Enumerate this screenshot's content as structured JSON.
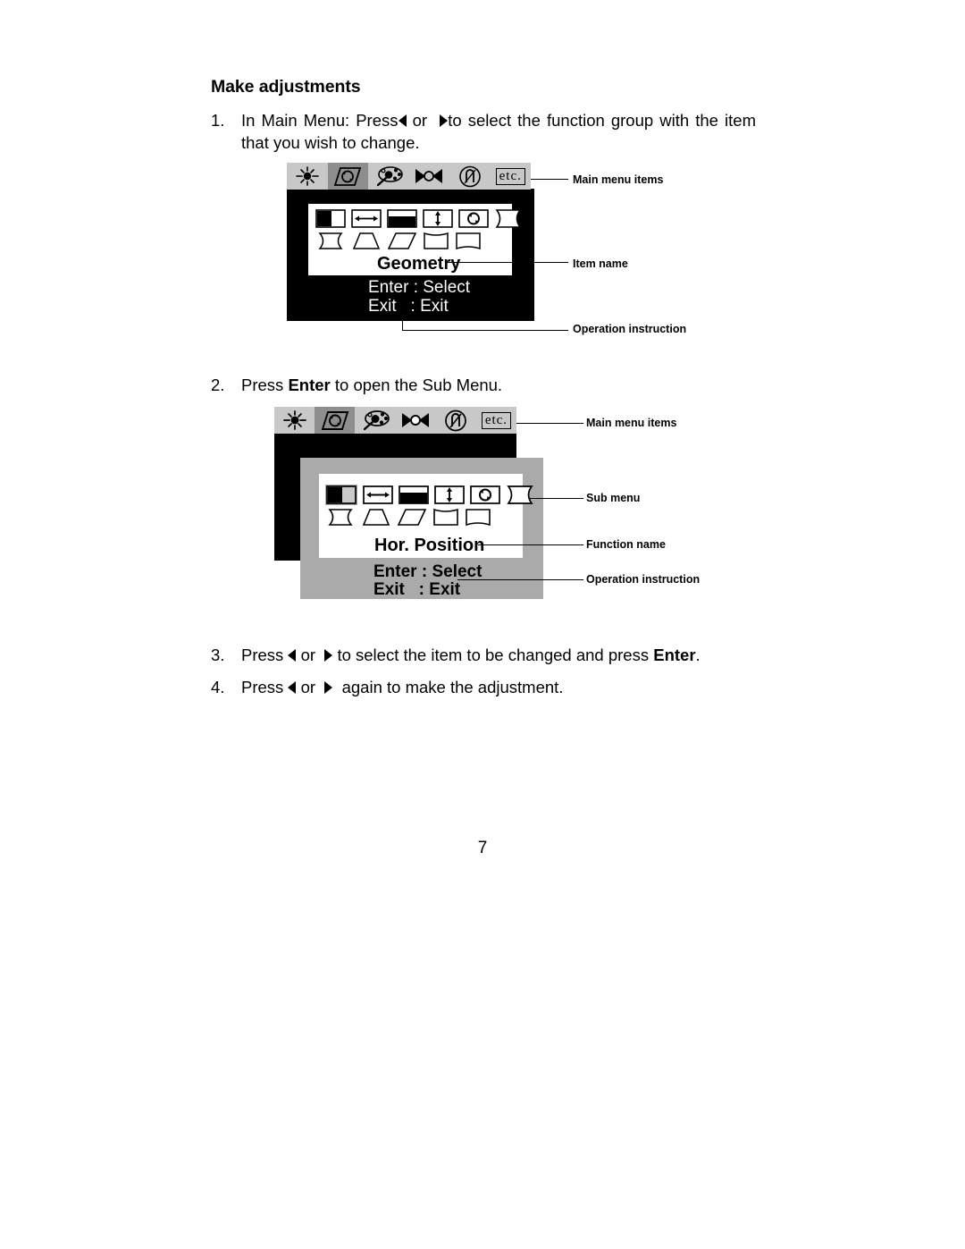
{
  "document": {
    "heading": "Make adjustments",
    "page_number": "7"
  },
  "steps": [
    {
      "num": "1.",
      "text_before": "In Main Menu: Press",
      "or": "or",
      "text_after": "to select the function group with the item that you wish to change."
    },
    {
      "num": "2.",
      "text_before": "Press",
      "bold": "Enter",
      "text_after": "to open the Sub Menu."
    },
    {
      "num": "3.",
      "text_before": "Press",
      "or": "or",
      "text_mid": "to select the item to be changed and press",
      "bold": "Enter",
      "period": "."
    },
    {
      "num": "4.",
      "text_before": "Press",
      "or": "or",
      "text_after": "again to make the adjustment."
    }
  ],
  "osd_main_menu_icons": [
    {
      "name": "brightness-contrast-icon",
      "label": "",
      "selected": false
    },
    {
      "name": "geometry-icon",
      "label": "",
      "selected": true
    },
    {
      "name": "color-palette-icon",
      "label": "",
      "selected": false
    },
    {
      "name": "convergence-icon",
      "label": "",
      "selected": false
    },
    {
      "name": "degauss-icon",
      "label": "",
      "selected": false
    },
    {
      "name": "etc-icon",
      "label": "etc.",
      "selected": false
    }
  ],
  "osd_submenu_icons": [
    {
      "name": "h-position-icon"
    },
    {
      "name": "h-size-icon"
    },
    {
      "name": "v-position-icon"
    },
    {
      "name": "v-size-icon"
    },
    {
      "name": "rotation-icon"
    },
    {
      "name": "pincushion-icon"
    },
    {
      "name": "pin-balance-icon"
    },
    {
      "name": "trapezoid-icon"
    },
    {
      "name": "parallelogram-icon"
    },
    {
      "name": "top-corner-icon"
    },
    {
      "name": "bottom-corner-icon"
    }
  ],
  "figure1": {
    "item_name": "Geometry",
    "instruction_line1": "Enter : Select",
    "instruction_line2": "Exit   : Exit",
    "callouts": {
      "main_menu_items": "Main menu items",
      "item_name": "Item name",
      "operation_instruction": "Operation instruction"
    }
  },
  "figure2": {
    "function_name": "Hor. Position",
    "instruction_line1": "Enter : Select",
    "instruction_line2": "Exit   : Exit",
    "callouts": {
      "main_menu_items": "Main menu items",
      "sub_menu": "Sub menu",
      "function_name": "Function name",
      "operation_instruction": "Operation instruction"
    }
  },
  "colors": {
    "osd_bar": "#c8c8c8",
    "osd_bar_selected": "#8e8e8e",
    "osd_black": "#000000",
    "osd_gray": "#aaaaaa",
    "osd_white": "#ffffff"
  }
}
